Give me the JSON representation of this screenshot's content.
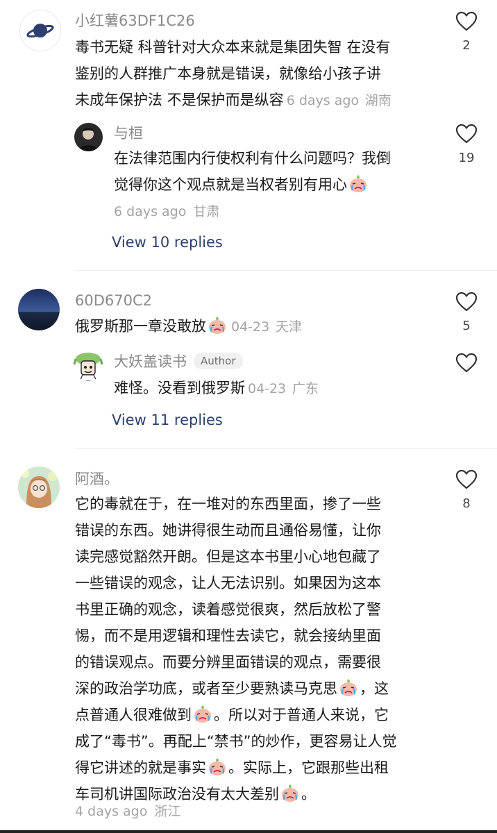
{
  "comments": [
    {
      "user": "小红薯63DF1C26",
      "text_lines": [
        "毒书无疑 科普针对大众本来就是集团失智 在没有",
        "鉴别的人群推广本身就是错误，就像给小孩子讲",
        "未成年保护法 不是保护而是纵容"
      ],
      "time": "6 days ago",
      "location": "湖南",
      "likes": "2",
      "reply": {
        "user": "与桓",
        "text_lines": [
          "在法律范围内行使权利有什么问题吗？我倒",
          "觉得你这个观点就是当权者别有用心"
        ],
        "time": "6 days ago",
        "location": "甘肃",
        "likes": "19"
      },
      "view_replies": "View 10 replies"
    },
    {
      "user": "60D670C2",
      "text": "俄罗斯那一章没敢放",
      "time": "04-23",
      "location": "天津",
      "likes": "5",
      "reply": {
        "user": "大妖盖读书",
        "tag": "Author",
        "text": "难怪。没看到俄罗斯",
        "time": "04-23",
        "location": "广东",
        "likes": ""
      },
      "view_replies": "View 11 replies"
    },
    {
      "user": "阿酒。",
      "lines": [
        [
          "它的毒就在于，在一堆对的东西里面，掺了一些"
        ],
        [
          "错误的东西。她讲得很生动而且通俗易懂，让你"
        ],
        [
          "读完感觉豁然开朗。但是这本书里小心地包藏了"
        ],
        [
          "一些错误的观念，让人无法识别。如果因为这本"
        ],
        [
          "书里正确的观念，读着感觉很爽，然后放松了警"
        ],
        [
          "惕，而不是用逻辑和理性去读它，就会接纳里面"
        ],
        [
          "的错误观点。而要分辨里面错误的观点，需要很"
        ],
        [
          "深的政治学功底，或者至少要熟读马克思",
          "，这"
        ],
        [
          "点普通人很难做到",
          "。所以对于普通人来说，它"
        ],
        [
          "成了“毒书”。再配上“禁书”的炒作，更容易让人觉"
        ],
        [
          "得它讲述的就是事实",
          "。实际上，它跟那些出租"
        ],
        [
          "车司机讲国际政治没有太大差别",
          "。"
        ]
      ],
      "time": "4 days ago",
      "location": "浙江",
      "likes": "8"
    }
  ],
  "icons": {
    "like": "heart-outline-icon",
    "emoji": "crying-face-emoji"
  },
  "colors": {
    "link": "#2b3f70",
    "meta": "#a3a3a3",
    "name": "#8a8a8a"
  }
}
